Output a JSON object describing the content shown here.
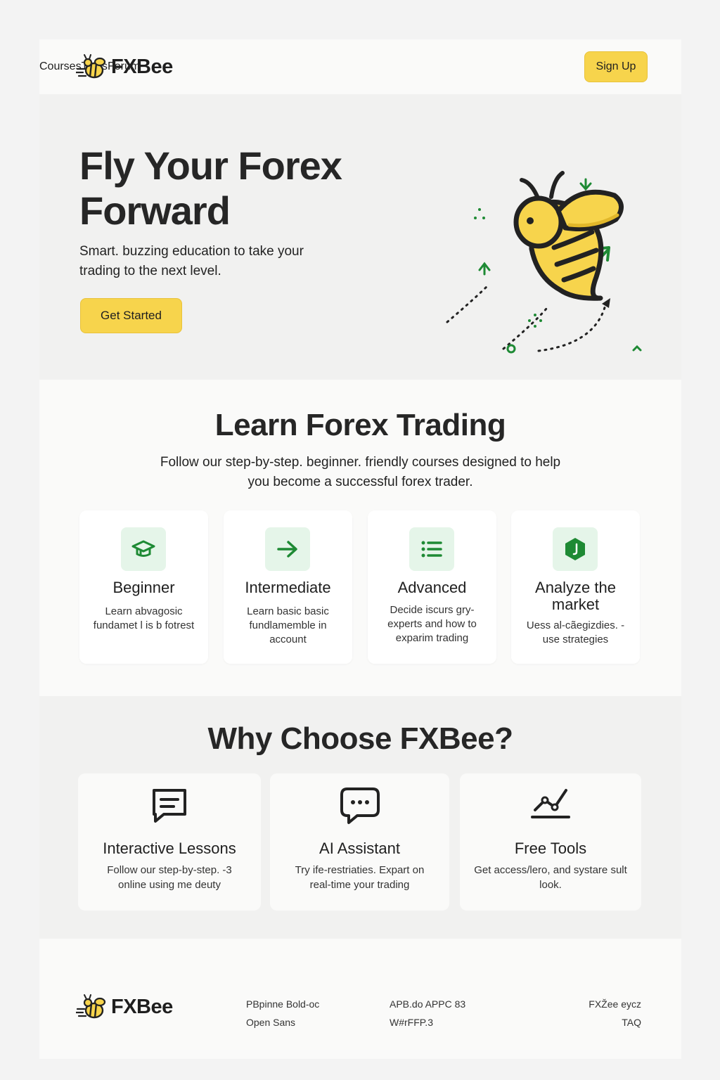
{
  "brand": {
    "name": "FXBee",
    "accent": "#f7d44c",
    "green": "#1e8a34"
  },
  "nav": {
    "items": [
      "Courses",
      "Tools",
      "Forum"
    ],
    "signup_label": "Sign Up"
  },
  "hero": {
    "title_line1": "Fly Your Forex",
    "title_line2": "Forward",
    "subtitle": "Smart. buzzing education to take your trading to the next level.",
    "cta_label": "Get Started"
  },
  "learn": {
    "title": "Learn Forex Trading",
    "subtitle": "Follow our step-by-step. beginner. friendly courses designed to help you become a successful forex trader.",
    "courses": [
      {
        "icon": "graduation-cap-icon",
        "title": "Beginner",
        "desc": "Learn abvagosic fundamet l is b fotrest"
      },
      {
        "icon": "arrow-right-icon",
        "title": "Intermediate",
        "desc": "Learn basic basic fundlamemble in account"
      },
      {
        "icon": "list-icon",
        "title": "Advanced",
        "desc": "Decide iscurs gry- experts and how to exparim trading"
      },
      {
        "icon": "hexagon-badge-icon",
        "title": "Analyze the market",
        "desc": "Uess al-cãegizdies. - use strategies"
      }
    ]
  },
  "why": {
    "title": "Why Choose FXBee?",
    "features": [
      {
        "icon": "chat-lines-icon",
        "title": "Interactive Lessons",
        "desc": "Follow our step-by-step. -3 online using me deuty"
      },
      {
        "icon": "chat-dots-icon",
        "title": "AI Assistant",
        "desc": "Try ife-restriaties. Expart on real-time your trading"
      },
      {
        "icon": "line-chart-icon",
        "title": "Free Tools",
        "desc": "Get access/lero, and systare sult look."
      }
    ]
  },
  "footer": {
    "col1": [
      "PBpinne Bold-oc",
      "Open Sans"
    ],
    "col2": [
      "APB.do APPC 83",
      "W#rFFP.3"
    ],
    "col3": [
      "FXŽee eycz",
      "TAQ"
    ]
  }
}
